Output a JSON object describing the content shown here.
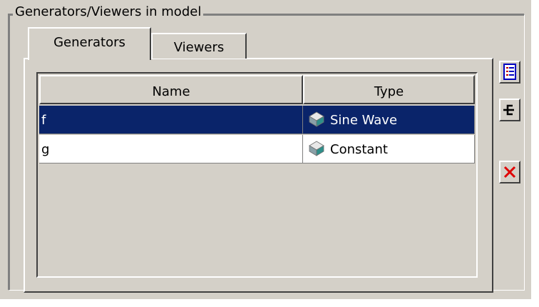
{
  "group": {
    "legend": "Generators/Viewers in model"
  },
  "tabs": [
    {
      "label": "Generators",
      "active": true
    },
    {
      "label": "Viewers",
      "active": false
    }
  ],
  "table": {
    "columns": [
      "Name",
      "Type"
    ],
    "rows": [
      {
        "name": "f",
        "type": "Sine Wave",
        "icon": "cube-icon",
        "selected": true
      },
      {
        "name": "g",
        "type": "Constant",
        "icon": "cube-icon",
        "selected": false
      }
    ]
  },
  "side_buttons": [
    {
      "icon": "document-list-icon"
    },
    {
      "icon": "connector-icon"
    },
    {
      "icon": "delete-x-icon",
      "color": "#e00000"
    }
  ],
  "colors": {
    "panel": "#d4d0c8",
    "selection": "#0a246a",
    "selection_text": "#ffffff"
  }
}
